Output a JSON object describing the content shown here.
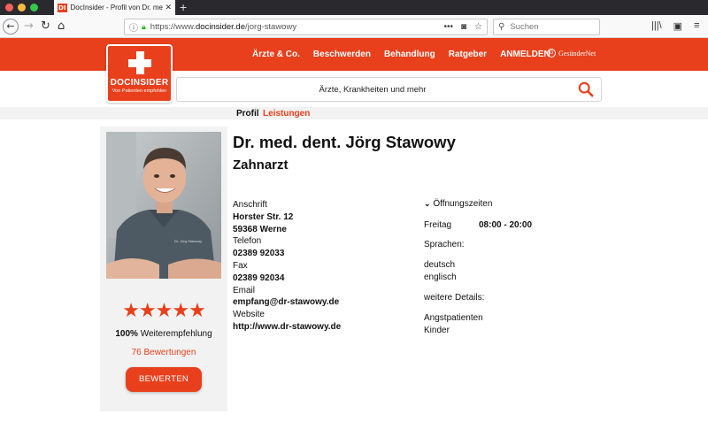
{
  "browser": {
    "tab_title": "DocInsider - Profil von Dr. med",
    "tab_favicon": "DI",
    "close_glyph": "✕",
    "newtab_glyph": "+",
    "url_scheme": "https://www.",
    "url_host": "docinsider.de",
    "url_path": "/jorg-stawowy",
    "search_placeholder": "Suchen",
    "traffic_colors": [
      "#fc605c",
      "#fdbc40",
      "#34c84a"
    ]
  },
  "site": {
    "brand": "DOCINSIDER",
    "tagline": "Von Patienten empfohlen",
    "accent_color": "#e8401c",
    "nav": [
      "Ärzte & Co.",
      "Beschwerden",
      "Behandlung",
      "Ratgeber",
      "ANMELDEN"
    ],
    "partner": "GesünderNet",
    "search_placeholder": "Ärzte, Krankheiten und mehr"
  },
  "subtabs": {
    "profil": "Profil",
    "leistungen": "Leistungen"
  },
  "doctor": {
    "name": "Dr. med. dent. Jörg Stawowy",
    "specialty": "Zahnarzt",
    "shirt_label": "Dr. Jörg Stawowy",
    "rating_stars": "★★★★★",
    "rating": 5,
    "recommend_percent": "100%",
    "recommend_label": "Weiterempfehlung",
    "reviews": "76 Bewertungen",
    "rate_button": "BEWERTEN"
  },
  "contact": {
    "address_label": "Anschrift",
    "street": "Horster Str. 12",
    "city": "59368 Werne",
    "phone_label": "Telefon",
    "phone": "02389 92033",
    "fax_label": "Fax",
    "fax": "02389 92034",
    "email_label": "Email",
    "email": "empfang@dr-stawowy.de",
    "website_label": "Website",
    "website": "http://www.dr-stawowy.de"
  },
  "hours": {
    "toggle_label": "Öffnungszeiten",
    "day": "Freitag",
    "time": "08:00 - 20:00",
    "languages_label": "Sprachen:",
    "languages": [
      "deutsch",
      "englisch"
    ],
    "details_label": "weitere Details:",
    "details": [
      "Angstpatienten",
      "Kinder"
    ]
  }
}
